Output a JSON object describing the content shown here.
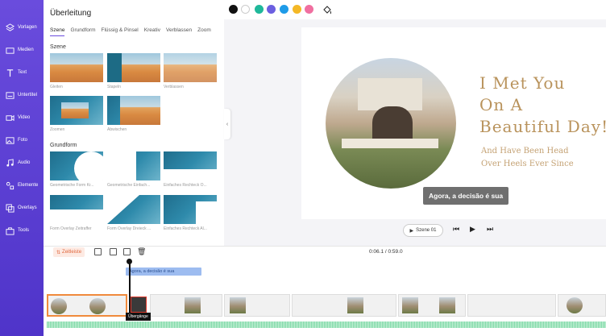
{
  "nav": {
    "items": [
      {
        "label": "Vorlagen",
        "icon": "layers-icon"
      },
      {
        "label": "Medien",
        "icon": "folder-icon"
      },
      {
        "label": "Text",
        "icon": "text-icon"
      },
      {
        "label": "Untertitel",
        "icon": "subtitle-icon"
      },
      {
        "label": "Video",
        "icon": "video-icon"
      },
      {
        "label": "Foto",
        "icon": "photo-icon"
      },
      {
        "label": "Audio",
        "icon": "music-icon"
      },
      {
        "label": "Elemente",
        "icon": "shapes-icon"
      },
      {
        "label": "Overlays",
        "icon": "overlay-icon"
      },
      {
        "label": "Tools",
        "icon": "toolbox-icon"
      }
    ]
  },
  "panel": {
    "title": "Überleitung",
    "tabs": [
      "Szene",
      "Grundform",
      "Flüssig & Pinsel",
      "Kreativ",
      "Verblassen",
      "Zoom"
    ],
    "active_tab": "Szene",
    "sections": {
      "scene": {
        "title": "Szene",
        "items": [
          "Gleiten",
          "Stapeln",
          "Verblassen",
          "Zoomen",
          "Abwischen"
        ]
      },
      "shape": {
        "title": "Grundform",
        "items": [
          "Geometrische Form Kr...",
          "Geometrische Einfach...",
          "Einfaches Rechteck O...",
          "Form Overlay Zeitraffer",
          "Form Overlay Dreieck ...",
          "Einfaches Rechteck Al..."
        ]
      }
    }
  },
  "colors": [
    "#111111",
    "#ffffff",
    "#1fb89a",
    "#6b5fe0",
    "#1e9be8",
    "#f4b826",
    "#f06fa0"
  ],
  "stage": {
    "headline": [
      "I Met You",
      "On A",
      "Beautiful Day!"
    ],
    "sub": [
      "And Have Been Head",
      "Over Heels Ever Since"
    ],
    "caption": "Agora, a decisão é sua"
  },
  "controls": {
    "scene_label": "Szene 01"
  },
  "timeline": {
    "zeitleiste_label": "Zeitleiste",
    "timecode": "0:06.1 / 0:59.0",
    "subtitle_clip": "Agora, a decisão é sua",
    "transition_label": "Übergänge"
  }
}
